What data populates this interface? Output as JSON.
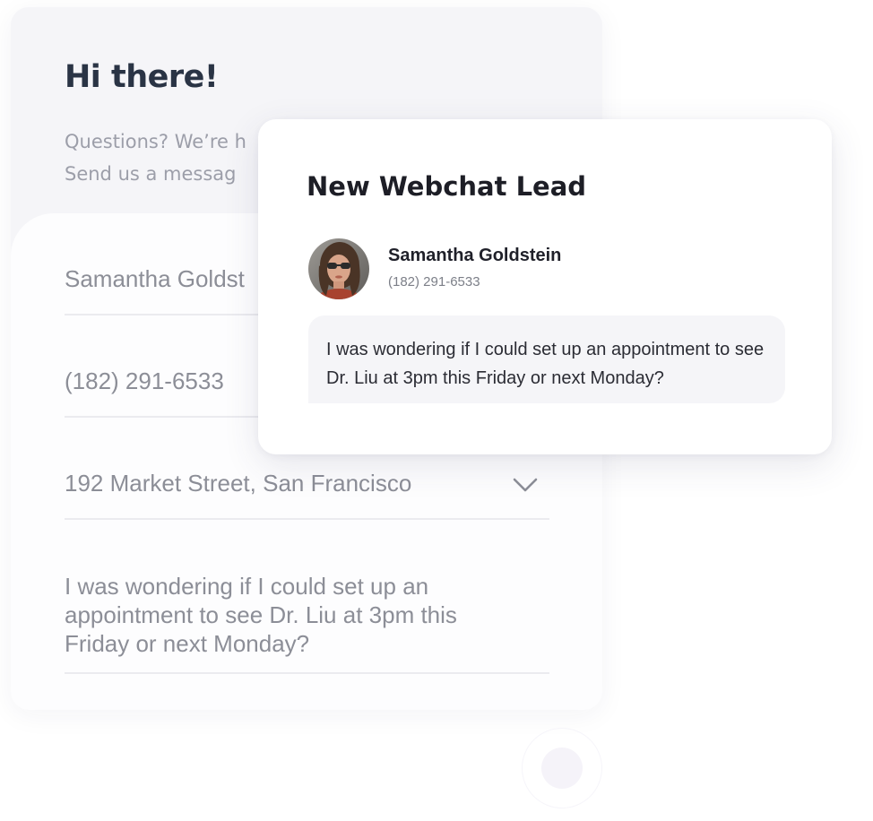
{
  "form": {
    "greeting": "Hi there!",
    "subtitle_line1": "Questions? We’re h",
    "subtitle_line2": "Send us a messag",
    "fields": {
      "name": "Samantha Goldst",
      "phone": "(182) 291-6533",
      "address": "192 Market Street, San Francisco",
      "message": "I was wondering if I could set up an appointment to see Dr. Liu at 3pm this Friday or next Monday?"
    }
  },
  "lead": {
    "title": "New Webchat Lead",
    "contact_name": "Samantha Goldstein",
    "contact_phone": "(182) 291-6533",
    "message": "I was wondering if I could set up an appointment to see Dr. Liu at 3pm this Friday or next Monday?"
  },
  "colors": {
    "heading": "#2a3445",
    "muted_text": "#9c9ea9",
    "field_text": "#8c8e97",
    "card_bg": "#ffffff",
    "panel_bg": "#f5f5f8"
  },
  "icons": {
    "dropdown": "chevron-down-icon",
    "avatar": "contact-avatar-photo"
  }
}
